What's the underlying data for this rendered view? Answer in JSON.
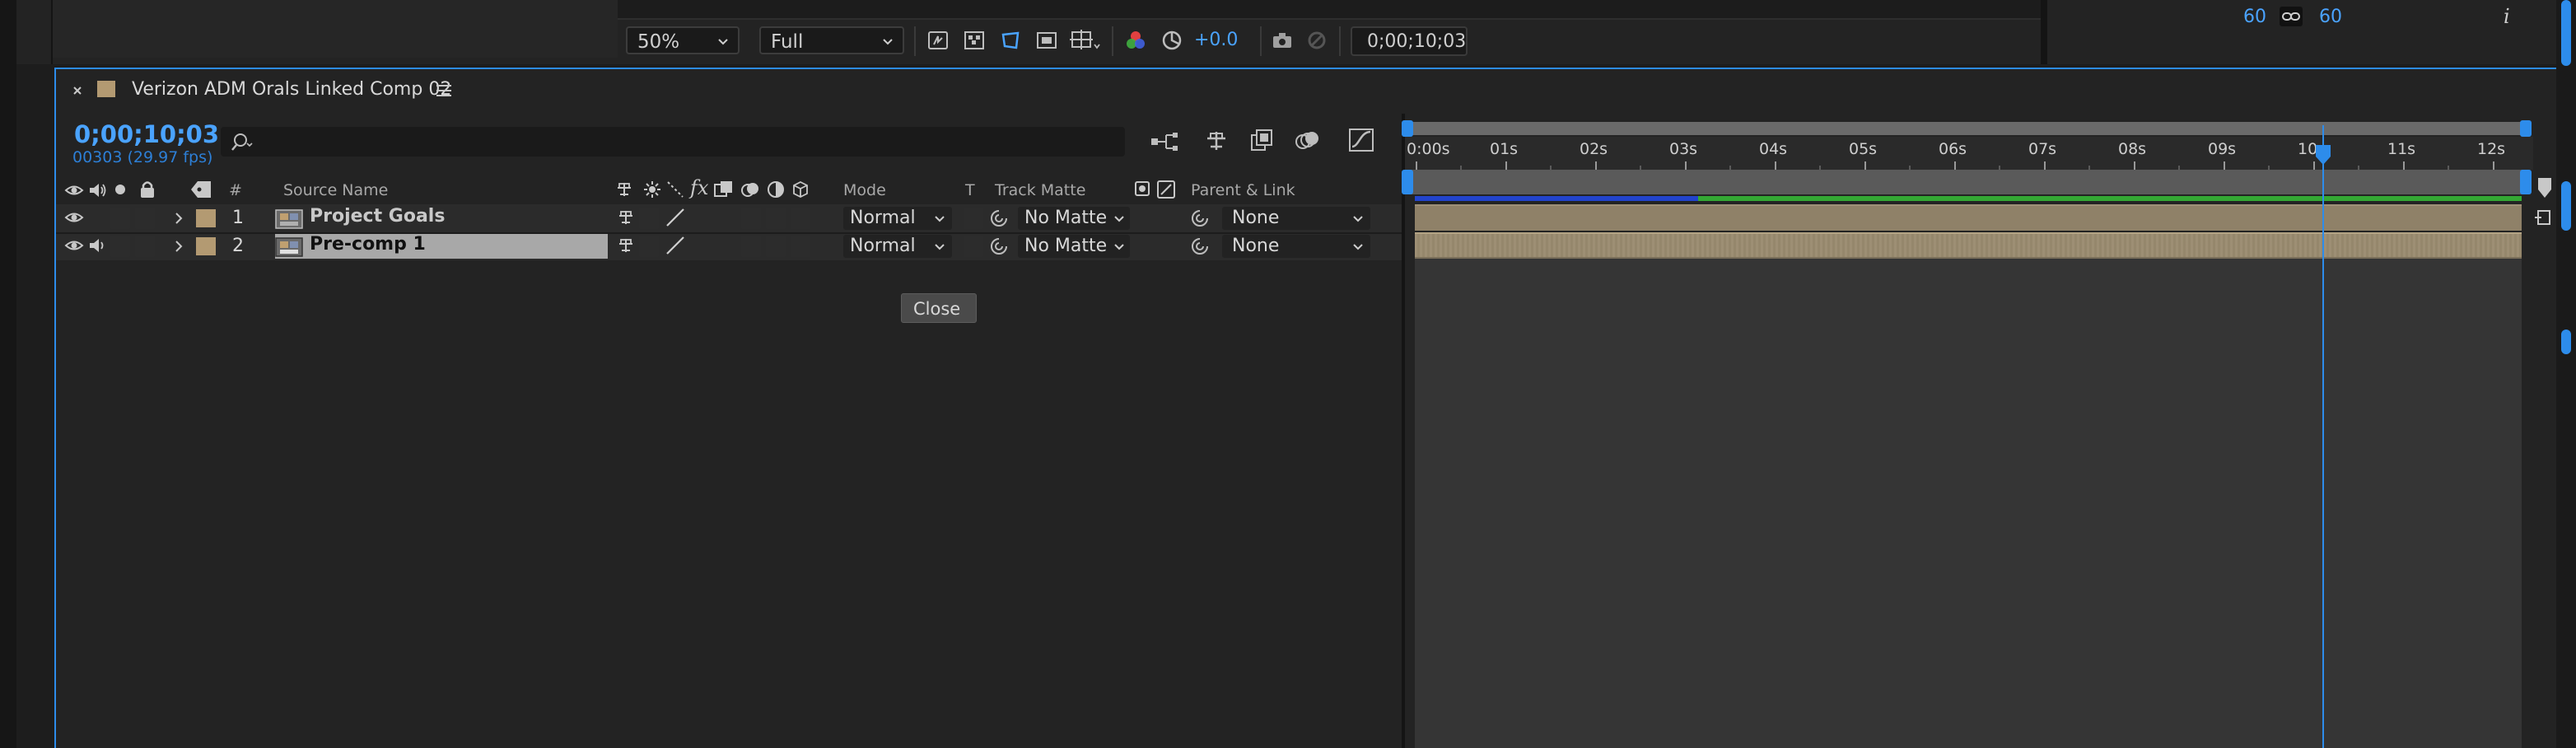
{
  "viewer_toolbar": {
    "magnification": "50%",
    "resolution": "Full",
    "exposure": "+0.0",
    "timecode": "0;00;10;03"
  },
  "info_panel": {
    "width_value": "60",
    "height_value": "60",
    "info_glyph": "i"
  },
  "composition": {
    "tab_title": "Verizon ADM Orals Linked Comp 02",
    "current_time": "0;00;10;03",
    "frame_info": "00303 (29.97 fps)",
    "search_placeholder": ""
  },
  "columns": {
    "number": "#",
    "source_name": "Source Name",
    "mode": "Mode",
    "t": "T",
    "track_matte": "Track Matte",
    "parent_link": "Parent & Link"
  },
  "layers": [
    {
      "number": "1",
      "name": "Project Goals",
      "mode": "Normal",
      "track_matte": "No Matte",
      "parent": "None",
      "label_color": "#b39a72"
    },
    {
      "number": "2",
      "name": "Pre-comp 1",
      "mode": "Normal",
      "track_matte": "No Matte",
      "parent": "None",
      "label_color": "#b39a72"
    }
  ],
  "tooltip": {
    "label": "Close"
  },
  "ruler": {
    "ticks": [
      "0:00s",
      "01s",
      "02s",
      "03s",
      "04s",
      "05s",
      "06s",
      "07s",
      "08s",
      "09s",
      "10s",
      "11s",
      "12s"
    ],
    "playhead_seconds": 10.1
  },
  "colors": {
    "accent": "#2d8ceb",
    "layer_bar": "#8f8168",
    "label_tan": "#b39a72",
    "render_green": "#34a834",
    "render_blue": "#2244cc"
  },
  "icons": {
    "close": "close-icon",
    "menu": "hamburger-menu-icon",
    "search": "search-icon",
    "eye": "eye-icon",
    "audio": "speaker-icon",
    "solo": "solo-icon",
    "lock": "lock-icon",
    "label": "label-tag-icon"
  }
}
